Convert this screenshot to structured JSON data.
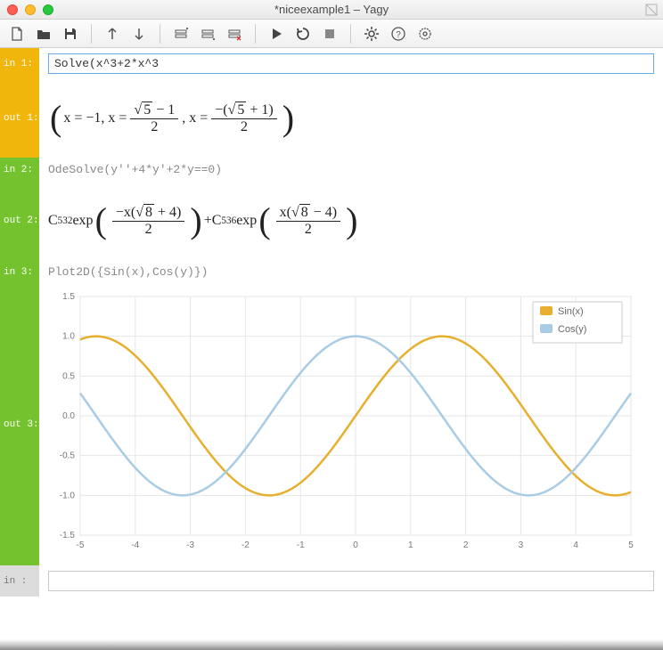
{
  "window": {
    "title": "*niceexample1 – Yagy"
  },
  "toolbar": {
    "items": [
      "new",
      "open",
      "save",
      "sep",
      "up",
      "down",
      "sep",
      "cell-above",
      "cell-below",
      "cell-delete",
      "sep",
      "run",
      "restart",
      "stop",
      "sep",
      "settings",
      "help",
      "target"
    ]
  },
  "cells": [
    {
      "type": "in",
      "index": 1,
      "gutter_in": "in  1:",
      "input_value": "Solve(x^3+2*x^3",
      "active": true,
      "gutter_out": "out 1:",
      "output_parts": {
        "p1": "x = −1, x = ",
        "num1_sqrt": "5",
        "num1_tail": " − 1",
        "den1": "2",
        "mid": " , x = ",
        "num2_pre": "−(",
        "num2_sqrt": "5",
        "num2_tail": " + 1)",
        "den2": "2"
      }
    },
    {
      "type": "in",
      "index": 2,
      "gutter_in": "in  2:",
      "input_text": "OdeSolve(y''+4*y'+2*y==0)",
      "gutter_out": "out 2:",
      "output_parts": {
        "c1": "C",
        "c1_sub": "532",
        "exp1": " exp",
        "f1_num_pre": "−x(",
        "f1_sqrt": "8",
        "f1_num_tail": " + 4)",
        "f1_den": "2",
        "plus": " + ",
        "c2": "C",
        "c2_sub": "536",
        "exp2": " exp",
        "f2_num_pre": "x(",
        "f2_sqrt": "8",
        "f2_num_tail": " − 4)",
        "f2_den": "2"
      }
    },
    {
      "type": "in",
      "index": 3,
      "gutter_in": "in  3:",
      "input_text": "Plot2D({Sin(x),Cos(y)})",
      "gutter_out": "out 3:"
    },
    {
      "type": "empty",
      "gutter_in": "in  :",
      "input_value": ""
    }
  ],
  "chart_data": {
    "type": "line",
    "title": "",
    "xlabel": "",
    "ylabel": "",
    "xlim": [
      -5,
      5
    ],
    "ylim": [
      -1.5,
      1.5
    ],
    "xticks": [
      -5,
      -4,
      -3,
      -2,
      -1,
      0,
      1,
      2,
      3,
      4,
      5
    ],
    "yticks": [
      -1.5,
      -1.0,
      -0.5,
      0.0,
      0.5,
      1.0,
      1.5
    ],
    "grid": true,
    "legend": {
      "position": "top-right",
      "entries": [
        "Sin(x)",
        "Cos(y)"
      ]
    },
    "series": [
      {
        "name": "Sin(x)",
        "color": "#e6b02e",
        "fn": "sin"
      },
      {
        "name": "Cos(y)",
        "color": "#a9cce5",
        "fn": "cos"
      }
    ]
  },
  "colors": {
    "active_gutter": "#f1b60c",
    "green_gutter": "#74c22e",
    "empty_gutter": "#dcdcdc",
    "sin": "#e6b02e",
    "cos": "#a9cce5"
  }
}
